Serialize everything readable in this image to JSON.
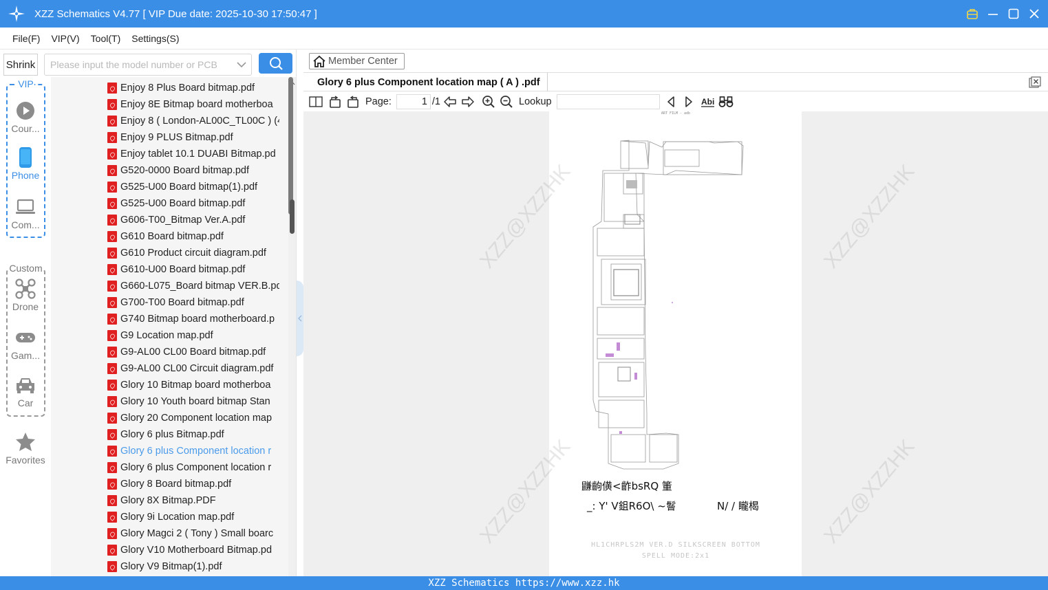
{
  "window": {
    "title": "XZZ Schematics V4.77 [ VIP Due date: 2025-10-30 17:50:47 ]"
  },
  "menu": {
    "items": [
      "File(F)",
      "VIP(V)",
      "Tool(T)",
      "Settings(S)"
    ]
  },
  "search": {
    "shrink_label": "Shrink",
    "placeholder": "Please input the model number or PCB"
  },
  "rail": {
    "vip_label": "VIP",
    "custom_label": "Custom",
    "items": [
      {
        "label": "Cour...",
        "icon": "play-circle-icon"
      },
      {
        "label": "Phone",
        "icon": "phone-icon"
      },
      {
        "label": "Com...",
        "icon": "laptop-icon"
      },
      {
        "label": "Drone",
        "icon": "drone-icon"
      },
      {
        "label": "Gam...",
        "icon": "gamepad-icon"
      },
      {
        "label": "Car",
        "icon": "car-icon"
      },
      {
        "label": "Favorites",
        "icon": "star-icon"
      }
    ]
  },
  "files": [
    "Enjoy 8 Plus Board bitmap.pdf",
    "Enjoy 8E Bitmap board motherboa",
    "Enjoy 8 ( London-AL00C_TL00C ) (4",
    "Enjoy 9 PLUS Bitmap.pdf",
    "Enjoy tablet 10.1 DUABI Bitmap.pd",
    "G520-0000 Board bitmap.pdf",
    "G525-U00 Board bitmap(1).pdf",
    "G525-U00 Board bitmap.pdf",
    "G606-T00_Bitmap Ver.A.pdf",
    "G610 Board bitmap.pdf",
    "G610 Product circuit diagram.pdf",
    "G610-U00 Board bitmap.pdf",
    "G660-L075_Board bitmap VER.B.pd",
    "G700-T00 Board bitmap.pdf",
    "G740 Bitmap board motherboard.p",
    "G9 Location map.pdf",
    "G9-AL00 CL00 Board bitmap.pdf",
    "G9-AL00 CL00 Circuit diagram.pdf",
    "Glory 10 Bitmap board motherboa",
    "Glory 10 Youth board bitmap Stan",
    "Glory 20 Component location map",
    "Glory 6 plus Bitmap.pdf",
    "Glory 6 plus Component location r",
    "Glory 6 plus Component location r",
    "Glory 8 Board bitmap.pdf",
    "Glory 8X Bitmap.PDF",
    "Glory 9i Location map.pdf",
    "Glory Magci 2 ( Tony ) Small boarc",
    "Glory V10 Motherboard Bitmap.pd",
    "Glory V9 Bitmap(1).pdf"
  ],
  "selected_file_index": 22,
  "viewer": {
    "member_center": "Member Center",
    "doc_tab": "Glory 6 plus Component location map ( A ) .pdf",
    "page_label": "Page:",
    "page_current": "1",
    "page_total": "/1",
    "lookup_label": "Lookup"
  },
  "pdf_page": {
    "header_text": "ART FILM - adb",
    "garbled_line1": "鼸齣僙<齚bsRQ 箽",
    "garbled_line2": "_: Y' V鉏R6O\\ ~鬙",
    "garbled_line3": "N/ / 矓楬",
    "footer_line1": "HL1CHRPLS2M VER.D SILKSCREEN BOTTOM",
    "footer_line2": "SPELL MODE:2x1",
    "watermark": "XZZ@XZZHK"
  },
  "status": {
    "text": "XZZ Schematics https://www.xzz.hk"
  },
  "colors": {
    "accent": "#3a8ee6",
    "selected_file": "#4b9bea",
    "pdf_icon": "#e02020"
  }
}
